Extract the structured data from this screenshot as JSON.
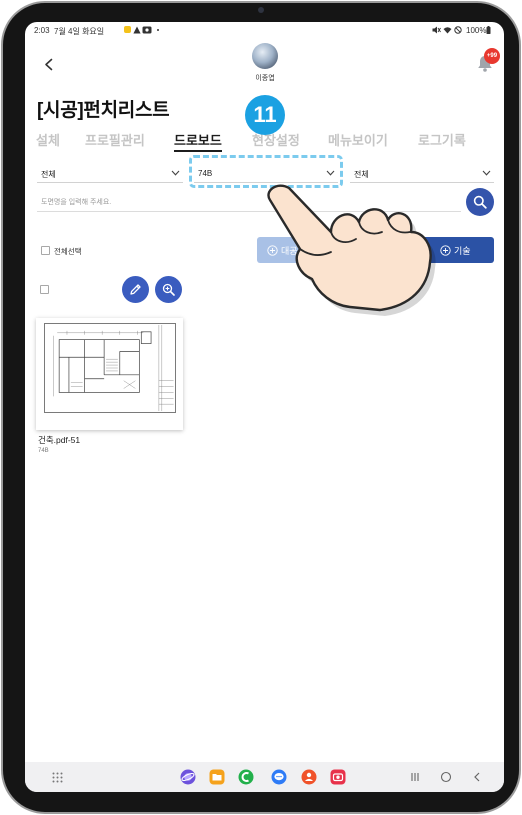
{
  "status_bar": {
    "time": "2:03",
    "date": "7월 4일 화요일",
    "battery_percent": "100%",
    "icons_left": [
      "app-notification-icon",
      "warning-icon",
      "gallery-icon",
      "dot-icon"
    ],
    "icons_right": [
      "mute-icon",
      "wifi-icon",
      "do-not-disturb-icon",
      "battery-icon"
    ]
  },
  "header": {
    "back_icon": "chevron-left-icon",
    "user_name": "이종엽",
    "bell_icon": "bell-icon",
    "notification_count": "+99"
  },
  "page_title": "[시공]펀치리스트",
  "step_marker": "11",
  "tabs": [
    {
      "label": "설체"
    },
    {
      "label": "프로필관리"
    },
    {
      "label": "드로보드"
    },
    {
      "label": "현장설정"
    },
    {
      "label": "메뉴보이기"
    },
    {
      "label": "로그기록"
    }
  ],
  "active_tab": 2,
  "filters": [
    {
      "value": "전체",
      "icon": "chevron-down-icon"
    },
    {
      "value": "74B",
      "icon": "chevron-down-icon",
      "highlighted": true
    },
    {
      "value": "전체",
      "icon": "chevron-down-icon"
    }
  ],
  "search": {
    "placeholder": "도면명을 입력해 주세요.",
    "icon": "search-icon"
  },
  "toolbar": {
    "select_all_label": "전체선택",
    "major_process_label": "대공",
    "tech_label": "기술",
    "button_icon": "plus-circle-icon",
    "edit_icon": "pencil-icon",
    "zoom_icon": "zoom-in-icon"
  },
  "drawings": [
    {
      "file_name": "건축.pdf-51",
      "tag": "74B"
    }
  ],
  "nav_bar": {
    "apps_icon": "app-grid-icon",
    "dock": [
      "internet-icon",
      "folder-icon",
      "phone-icon",
      "messages-icon",
      "contacts-icon",
      "camera-icon"
    ],
    "system": [
      "recent-apps-icon",
      "home-icon",
      "back-icon"
    ]
  },
  "overlay_icon": "pointing-hand-icon",
  "colors": {
    "primary": "#2b52a5",
    "primary_light": "#a9c1e6",
    "step_marker": "#1ba1e2",
    "highlight_dash": "#7ccbee",
    "badge_red": "#e8382f",
    "hand_skin": "#fbe3cf"
  }
}
